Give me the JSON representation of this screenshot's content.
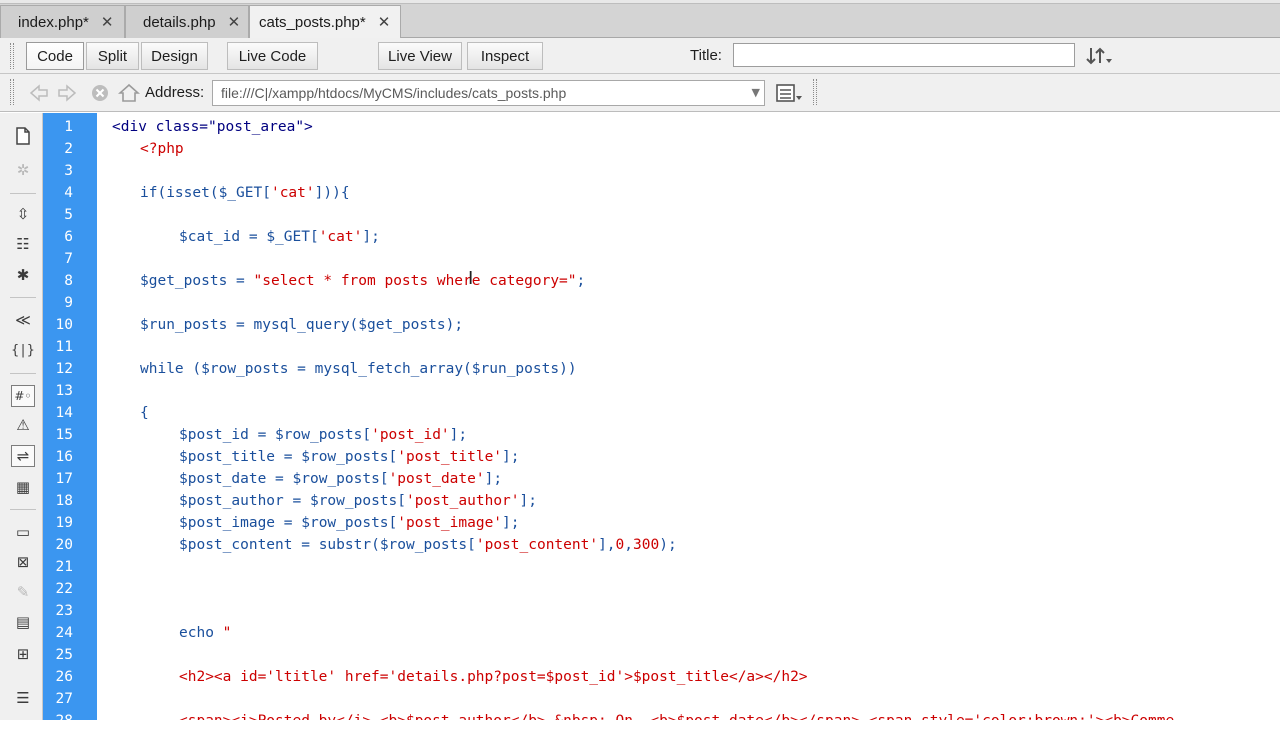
{
  "tabs": [
    {
      "label": "index.php*",
      "close": "✕"
    },
    {
      "label": "details.php",
      "close": "✕"
    },
    {
      "label": "cats_posts.php*",
      "close": "✕"
    }
  ],
  "toolbar": {
    "code": "Code",
    "split": "Split",
    "design": "Design",
    "live_code": "Live Code",
    "live_view": "Live View",
    "inspect": "Inspect",
    "title_label": "Title:",
    "title_value": ""
  },
  "address": {
    "label": "Address:",
    "value": "file:///C|/xampp/htdocs/MyCMS/includes/cats_posts.php"
  },
  "code_lines": [
    {
      "n": "1",
      "indent": 0,
      "parts": [
        [
          "tag",
          "<div class=\"post_area\">"
        ]
      ]
    },
    {
      "n": "2",
      "indent": 1,
      "parts": [
        [
          "php",
          "<?php"
        ]
      ]
    },
    {
      "n": "3",
      "indent": 0,
      "parts": []
    },
    {
      "n": "4",
      "indent": 1,
      "parts": [
        [
          "kw",
          "if(isset("
        ],
        [
          "var",
          "$_GET"
        ],
        [
          "op",
          "["
        ],
        [
          "str",
          "'cat'"
        ],
        [
          "op",
          "])){"
        ]
      ]
    },
    {
      "n": "5",
      "indent": 0,
      "parts": []
    },
    {
      "n": "6",
      "indent": 2,
      "parts": [
        [
          "var",
          "$cat_id"
        ],
        [
          "op",
          " = "
        ],
        [
          "var",
          "$_GET"
        ],
        [
          "op",
          "["
        ],
        [
          "str",
          "'cat'"
        ],
        [
          "op",
          "];"
        ]
      ]
    },
    {
      "n": "7",
      "indent": 0,
      "parts": []
    },
    {
      "n": "8",
      "indent": 1,
      "parts": [
        [
          "var",
          "$get_posts"
        ],
        [
          "op",
          " = "
        ],
        [
          "str",
          "\"select * from posts where category=\""
        ],
        [
          "op",
          ";"
        ]
      ]
    },
    {
      "n": "9",
      "indent": 0,
      "parts": []
    },
    {
      "n": "10",
      "indent": 1,
      "parts": [
        [
          "var",
          "$run_posts"
        ],
        [
          "op",
          " = "
        ],
        [
          "fn",
          "mysql_query("
        ],
        [
          "var",
          "$get_posts"
        ],
        [
          "op",
          ");"
        ]
      ]
    },
    {
      "n": "11",
      "indent": 0,
      "parts": []
    },
    {
      "n": "12",
      "indent": 1,
      "parts": [
        [
          "kw",
          "while "
        ],
        [
          "op",
          "("
        ],
        [
          "var",
          "$row_posts"
        ],
        [
          "op",
          " = "
        ],
        [
          "fn",
          "mysql_fetch_array("
        ],
        [
          "var",
          "$run_posts"
        ],
        [
          "op",
          "))"
        ]
      ]
    },
    {
      "n": "13",
      "indent": 0,
      "parts": []
    },
    {
      "n": "14",
      "indent": 1,
      "parts": [
        [
          "op",
          "{"
        ]
      ]
    },
    {
      "n": "15",
      "indent": 2,
      "parts": [
        [
          "var",
          "$post_id"
        ],
        [
          "op",
          " = "
        ],
        [
          "var",
          "$row_posts"
        ],
        [
          "op",
          "["
        ],
        [
          "str",
          "'post_id'"
        ],
        [
          "op",
          "];"
        ]
      ]
    },
    {
      "n": "16",
      "indent": 2,
      "parts": [
        [
          "var",
          "$post_title"
        ],
        [
          "op",
          " = "
        ],
        [
          "var",
          "$row_posts"
        ],
        [
          "op",
          "["
        ],
        [
          "str",
          "'post_title'"
        ],
        [
          "op",
          "];"
        ]
      ]
    },
    {
      "n": "17",
      "indent": 2,
      "parts": [
        [
          "var",
          "$post_date"
        ],
        [
          "op",
          " = "
        ],
        [
          "var",
          "$row_posts"
        ],
        [
          "op",
          "["
        ],
        [
          "str",
          "'post_date'"
        ],
        [
          "op",
          "];"
        ]
      ]
    },
    {
      "n": "18",
      "indent": 2,
      "parts": [
        [
          "var",
          "$post_author"
        ],
        [
          "op",
          " = "
        ],
        [
          "var",
          "$row_posts"
        ],
        [
          "op",
          "["
        ],
        [
          "str",
          "'post_author'"
        ],
        [
          "op",
          "];"
        ]
      ]
    },
    {
      "n": "19",
      "indent": 2,
      "parts": [
        [
          "var",
          "$post_image"
        ],
        [
          "op",
          " = "
        ],
        [
          "var",
          "$row_posts"
        ],
        [
          "op",
          "["
        ],
        [
          "str",
          "'post_image'"
        ],
        [
          "op",
          "];"
        ]
      ]
    },
    {
      "n": "20",
      "indent": 2,
      "parts": [
        [
          "var",
          "$post_content"
        ],
        [
          "op",
          " = "
        ],
        [
          "fn",
          "substr("
        ],
        [
          "var",
          "$row_posts"
        ],
        [
          "op",
          "["
        ],
        [
          "str",
          "'post_content'"
        ],
        [
          "op",
          "],"
        ],
        [
          "num",
          "0"
        ],
        [
          "op",
          ","
        ],
        [
          "num",
          "300"
        ],
        [
          "op",
          ");"
        ]
      ]
    },
    {
      "n": "21",
      "indent": 0,
      "parts": []
    },
    {
      "n": "22",
      "indent": 0,
      "parts": []
    },
    {
      "n": "23",
      "indent": 0,
      "parts": []
    },
    {
      "n": "24",
      "indent": 2,
      "parts": [
        [
          "kw",
          "echo "
        ],
        [
          "str",
          "\""
        ]
      ]
    },
    {
      "n": "25",
      "indent": 0,
      "parts": []
    },
    {
      "n": "26",
      "indent": 2,
      "parts": [
        [
          "str",
          "<h2><a id='ltitle' href='details.php?post=$post_id'>$post_title</a></h2>"
        ]
      ]
    },
    {
      "n": "27",
      "indent": 0,
      "parts": []
    },
    {
      "n": "28",
      "indent": 2,
      "parts": [
        [
          "str",
          "<span><i>Posted by</i> <b>$post_author</b> &nbsp; On  <b>$post_date</b></span> <span style='color:brown;'><b>Comme"
        ]
      ]
    }
  ],
  "icons": {
    "tab_close": "close-icon",
    "live_code_options": "inspect-options-icon",
    "browser": "globe-icon",
    "refresh": "refresh-icon",
    "file_management": "file-up-down-icon",
    "back": "back-arrow-icon",
    "forward": "forward-arrow-icon",
    "stop": "stop-icon",
    "home": "home-icon",
    "view_options": "list-options-icon"
  }
}
